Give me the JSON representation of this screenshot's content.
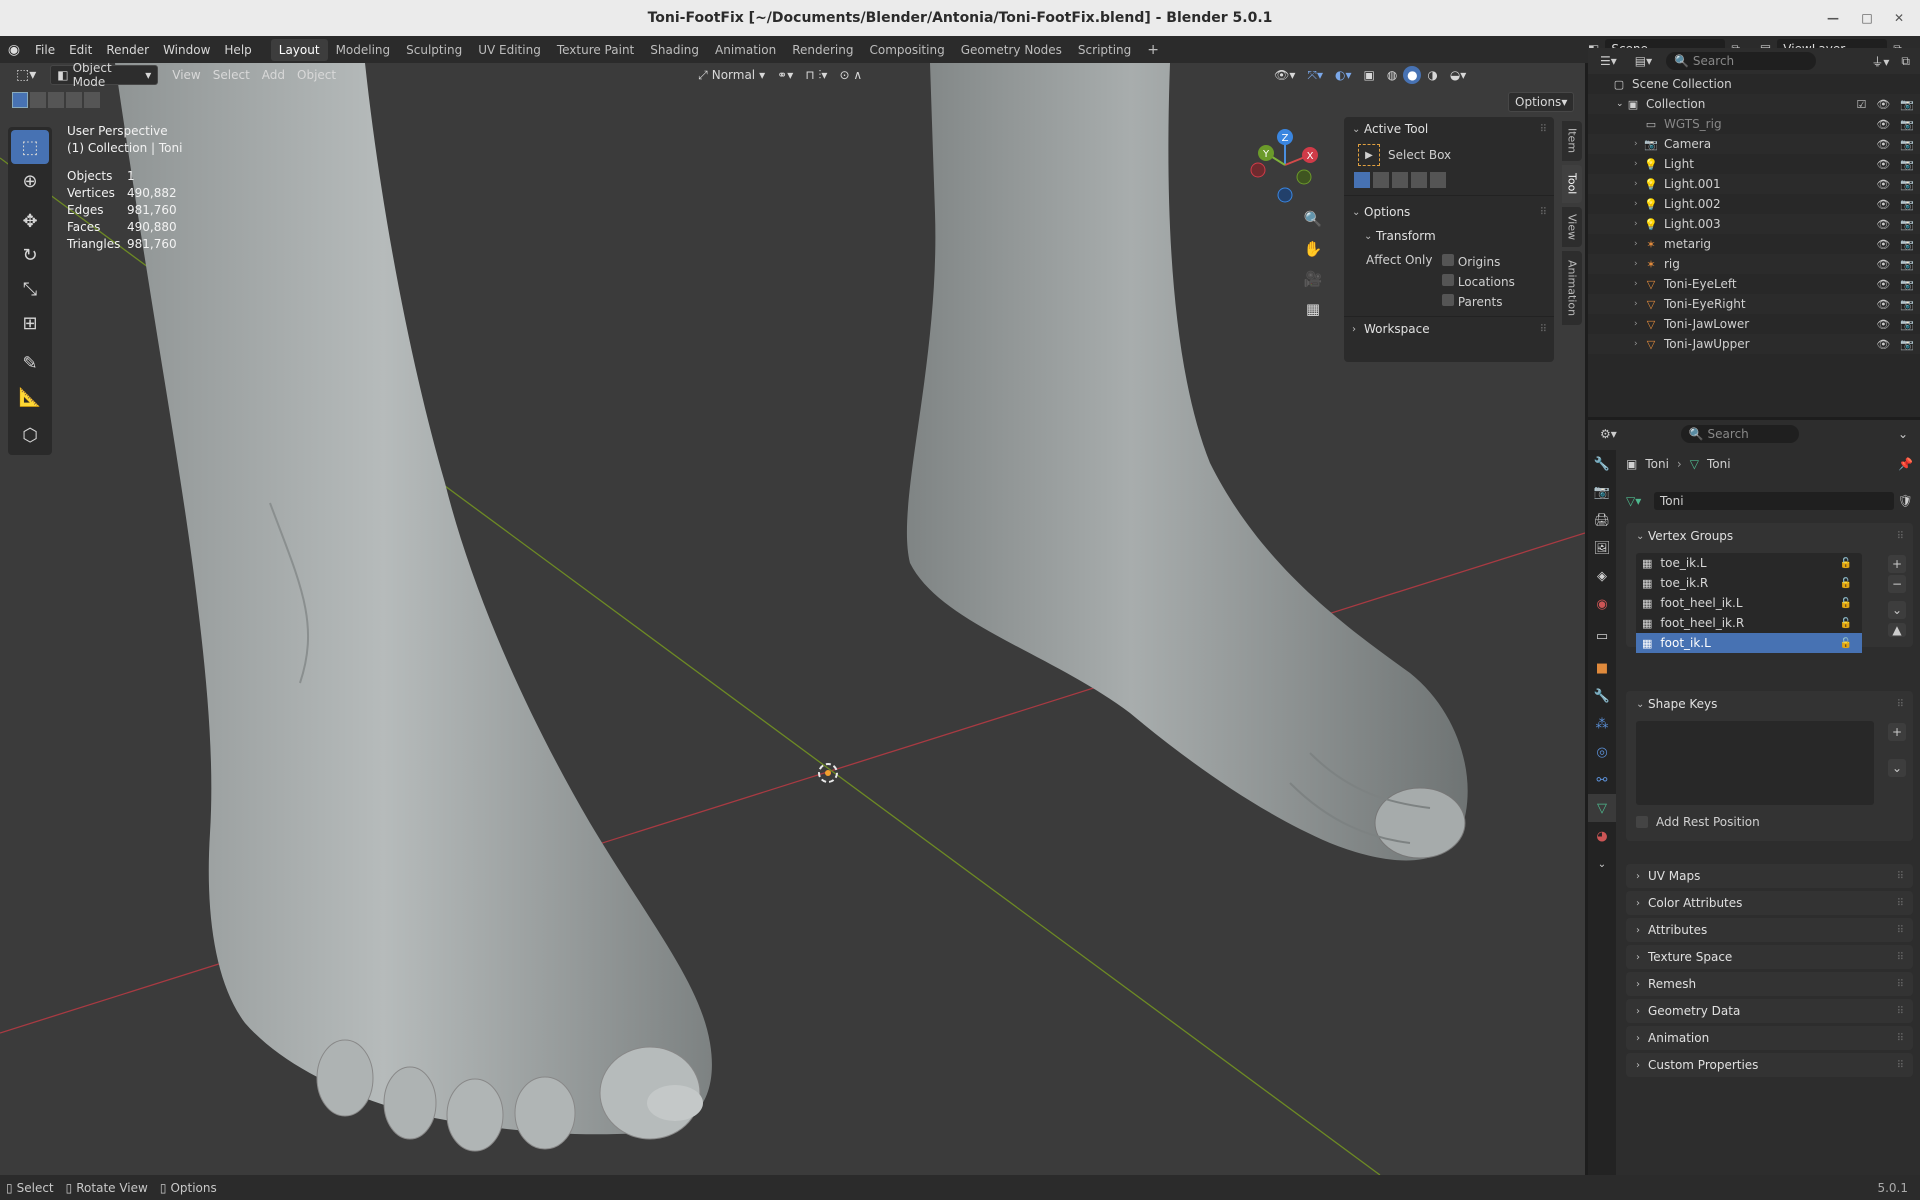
{
  "window": {
    "title": "Toni-FootFix [~/Documents/Blender/Antonia/Toni-FootFix.blend] - Blender 5.0.1"
  },
  "menu": [
    "File",
    "Edit",
    "Render",
    "Window",
    "Help"
  ],
  "workspaces": [
    "Layout",
    "Modeling",
    "Sculpting",
    "UV Editing",
    "Texture Paint",
    "Shading",
    "Animation",
    "Rendering",
    "Compositing",
    "Geometry Nodes",
    "Scripting"
  ],
  "active_workspace": "Layout",
  "scene": {
    "name": "Scene",
    "view_layer": "ViewLayer"
  },
  "viewport": {
    "mode": "Object Mode",
    "header_menus": [
      "View",
      "Select",
      "Add",
      "Object"
    ],
    "orientation": "Normal",
    "options_label": "Options",
    "perspective": "User Perspective",
    "collection_label": "(1) Collection | Toni",
    "stats": [
      {
        "label": "Objects",
        "value": "1"
      },
      {
        "label": "Vertices",
        "value": "490,882"
      },
      {
        "label": "Edges",
        "value": "981,760"
      },
      {
        "label": "Faces",
        "value": "490,880"
      },
      {
        "label": "Triangles",
        "value": "981,760"
      }
    ],
    "gizmo": {
      "x": "X",
      "y": "Y",
      "z": "Z"
    }
  },
  "npanel": {
    "tabs": [
      "Item",
      "Tool",
      "View",
      "Animation"
    ],
    "active_tab": "Tool",
    "active_tool_header": "Active Tool",
    "active_tool_name": "Select Box",
    "options_header": "Options",
    "transform_header": "Transform",
    "affect_only_label": "Affect Only",
    "affect_only": [
      "Origins",
      "Locations",
      "Parents"
    ],
    "workspace_header": "Workspace"
  },
  "outliner": {
    "search_placeholder": "Search",
    "scene_collection": "Scene Collection",
    "collection": "Collection",
    "items": [
      {
        "name": "WGTS_rig",
        "type": "collection"
      },
      {
        "name": "Camera",
        "type": "camera"
      },
      {
        "name": "Light",
        "type": "light"
      },
      {
        "name": "Light.001",
        "type": "light"
      },
      {
        "name": "Light.002",
        "type": "light"
      },
      {
        "name": "Light.003",
        "type": "light"
      },
      {
        "name": "metarig",
        "type": "armature"
      },
      {
        "name": "rig",
        "type": "armature"
      },
      {
        "name": "Toni-EyeLeft",
        "type": "mesh"
      },
      {
        "name": "Toni-EyeRight",
        "type": "mesh"
      },
      {
        "name": "Toni-JawLower",
        "type": "mesh"
      },
      {
        "name": "Toni-JawUpper",
        "type": "mesh"
      }
    ]
  },
  "properties": {
    "search_placeholder": "Search",
    "breadcrumb_object": "Toni",
    "breadcrumb_data": "Toni",
    "mesh_name": "Toni",
    "vertex_groups_header": "Vertex Groups",
    "vertex_groups": [
      "toe_ik.L",
      "toe_ik.R",
      "foot_heel_ik.L",
      "foot_heel_ik.R",
      "foot_ik.L"
    ],
    "selected_vertex_group": "foot_ik.L",
    "shape_keys_header": "Shape Keys",
    "add_rest_position": "Add Rest Position",
    "collapsed_panels": [
      "UV Maps",
      "Color Attributes",
      "Attributes",
      "Texture Space",
      "Remesh",
      "Geometry Data",
      "Animation",
      "Custom Properties"
    ]
  },
  "statusbar": {
    "select": "Select",
    "rotate": "Rotate View",
    "options": "Options",
    "version": "5.0.1"
  },
  "colors": {
    "accent": "#4772b3",
    "x_axis": "#c0404a",
    "y_axis": "#7a9a2a",
    "viewport_bg": "#3b3b3b",
    "object_orange": "#e08a3c",
    "mesh_green": "#4fb98e"
  }
}
